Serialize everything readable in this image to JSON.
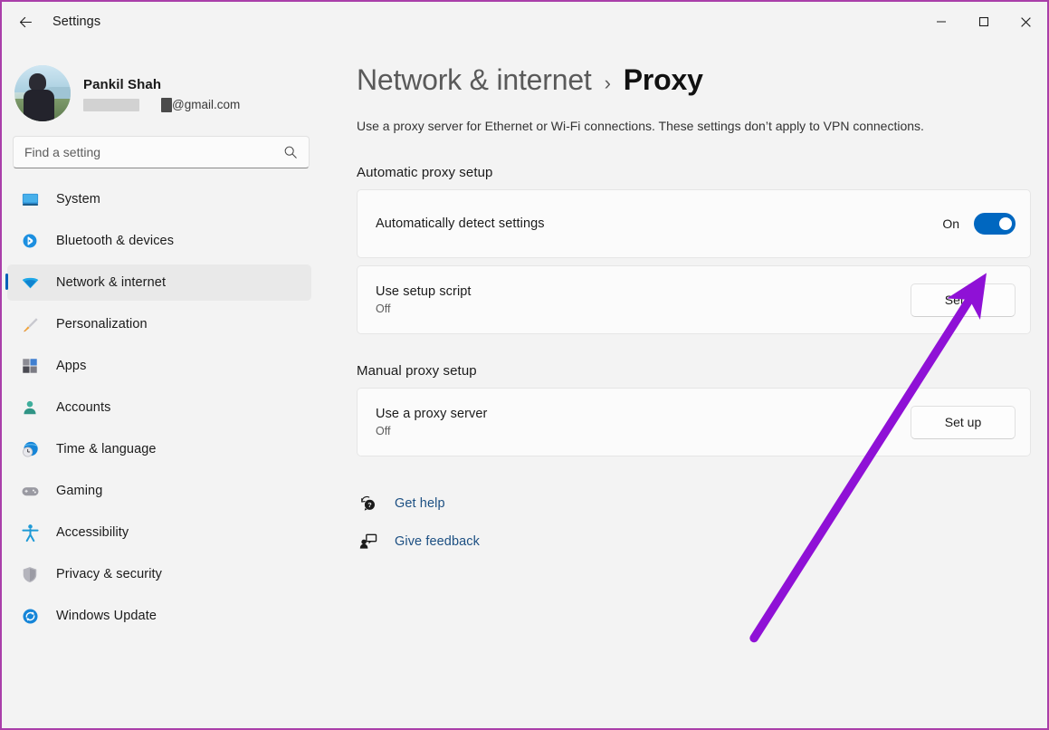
{
  "window": {
    "title": "Settings",
    "back_icon": "back-arrow-icon",
    "controls": {
      "minimize": "—",
      "maximize": "☐",
      "close": "✕"
    }
  },
  "account": {
    "name": "Pankil Shah",
    "email_domain": "@gmail.com",
    "email_redacted": true,
    "avatar_alt": "user-profile-photo"
  },
  "search": {
    "placeholder": "Find a setting",
    "value": "",
    "icon": "search-icon"
  },
  "sidebar": {
    "items": [
      {
        "label": "System",
        "icon": "system-icon",
        "selected": false
      },
      {
        "label": "Bluetooth & devices",
        "icon": "bluetooth-icon",
        "selected": false
      },
      {
        "label": "Network & internet",
        "icon": "wifi-icon",
        "selected": true
      },
      {
        "label": "Personalization",
        "icon": "paintbrush-icon",
        "selected": false
      },
      {
        "label": "Apps",
        "icon": "apps-icon",
        "selected": false
      },
      {
        "label": "Accounts",
        "icon": "person-icon",
        "selected": false
      },
      {
        "label": "Time & language",
        "icon": "clock-globe-icon",
        "selected": false
      },
      {
        "label": "Gaming",
        "icon": "gamepad-icon",
        "selected": false
      },
      {
        "label": "Accessibility",
        "icon": "accessibility-icon",
        "selected": false
      },
      {
        "label": "Privacy & security",
        "icon": "shield-icon",
        "selected": false
      },
      {
        "label": "Windows Update",
        "icon": "update-icon",
        "selected": false
      }
    ]
  },
  "main": {
    "breadcrumb": {
      "parent": "Network & internet",
      "separator": "›",
      "current": "Proxy"
    },
    "description": "Use a proxy server for Ethernet or Wi-Fi connections. These settings don’t apply to VPN connections.",
    "sections": [
      {
        "heading": "Automatic proxy setup",
        "cards": [
          {
            "title": "Automatically detect settings",
            "subtitle": "",
            "control": "toggle",
            "state_label": "On",
            "toggle_on": true
          },
          {
            "title": "Use setup script",
            "subtitle": "Off",
            "control": "button",
            "button_label": "Set up"
          }
        ]
      },
      {
        "heading": "Manual proxy setup",
        "cards": [
          {
            "title": "Use a proxy server",
            "subtitle": "Off",
            "control": "button",
            "button_label": "Set up"
          }
        ]
      }
    ],
    "links": [
      {
        "label": "Get help",
        "icon": "help-question-icon"
      },
      {
        "label": "Give feedback",
        "icon": "feedback-person-icon"
      }
    ]
  },
  "annotation": {
    "type": "arrow",
    "color": "#8f11d6",
    "points_to": "automatically-detect-settings-toggle"
  },
  "colors": {
    "accent": "#005fb8",
    "toggle_on": "#0067c0",
    "link": "#1c4f82",
    "page_bg": "#f3f3f3",
    "card_bg": "#fbfbfb",
    "annotation_purple": "#8f11d6"
  }
}
